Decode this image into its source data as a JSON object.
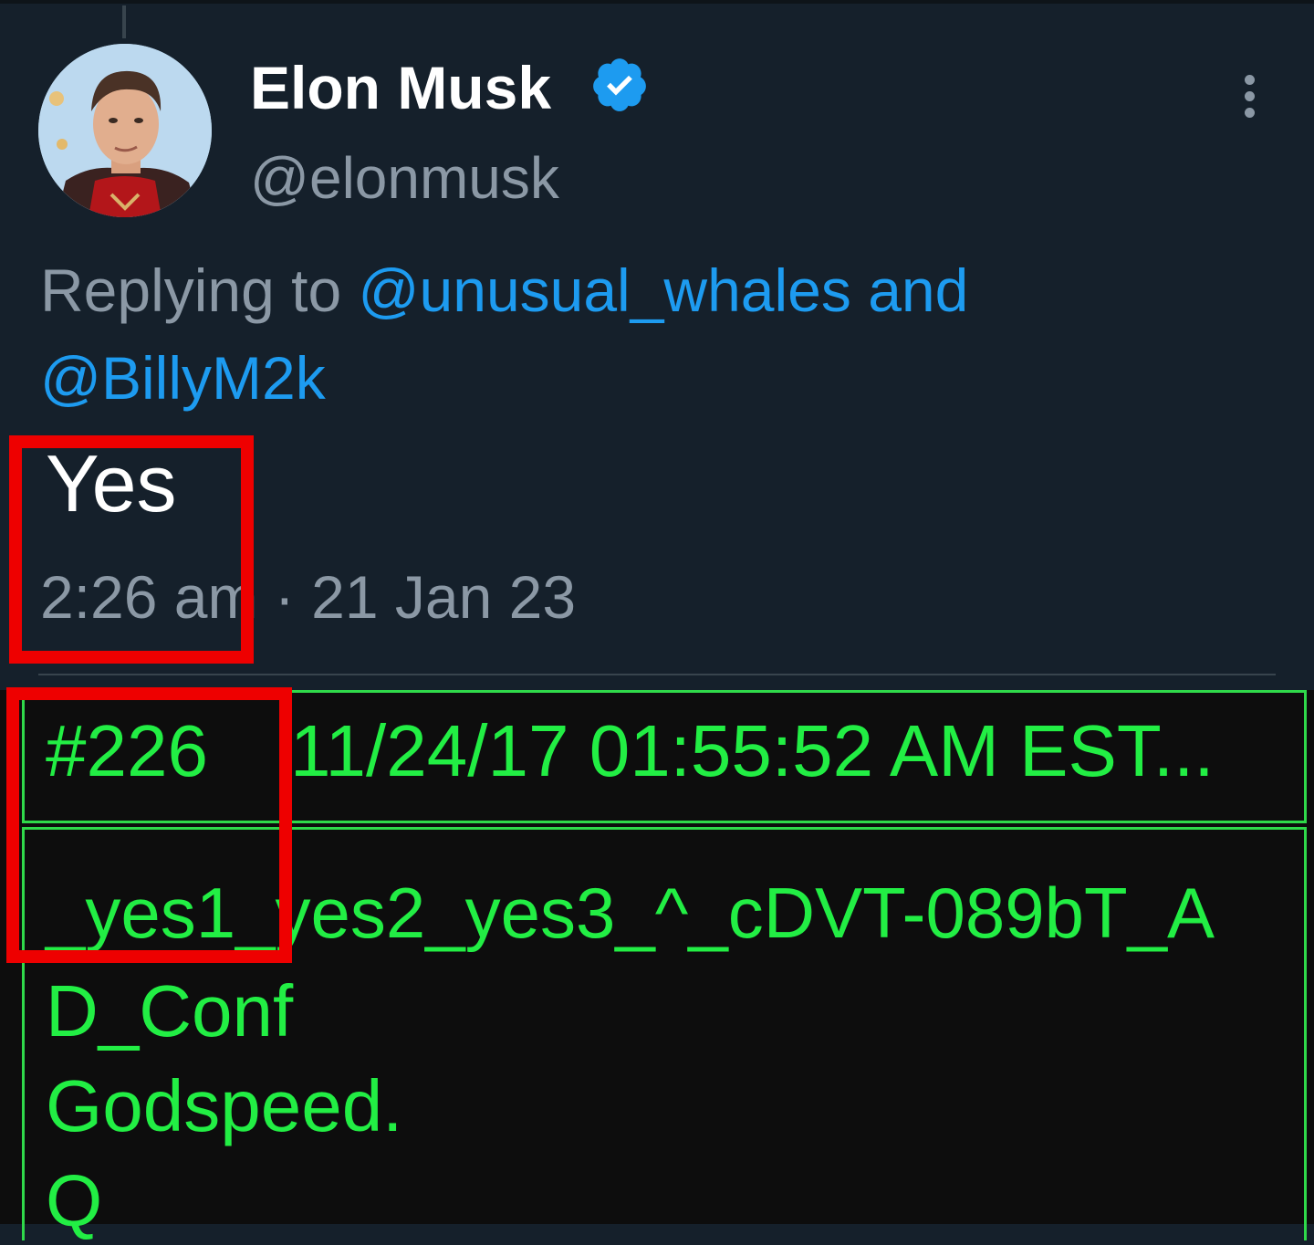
{
  "tweet": {
    "display_name": "Elon Musk",
    "handle": "@elonmusk",
    "reply_prefix": "Replying to ",
    "reply_user_1": "@unusual_whales",
    "reply_conjunction": " and",
    "reply_user_2": "@BillyM2k",
    "text": "Yes",
    "timestamp": "2:26 am · 21 Jan 23"
  },
  "post": {
    "id": "#226",
    "datetime": "11/24/17 01:55:52 AM EST...",
    "line1": "_yes1_yes2_yes3_^_cDVT-089bT_A",
    "line2": "D_Conf",
    "line3": "Godspeed.",
    "line4": "Q"
  },
  "colors": {
    "background": "#15202b",
    "link": "#1d9bf0",
    "terminal_green": "#22ee44",
    "highlight_red": "#ee0000"
  },
  "icons": [
    "verified-badge-icon",
    "more-options-icon"
  ]
}
